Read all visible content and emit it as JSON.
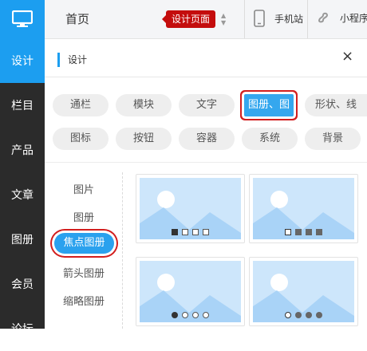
{
  "leftnav": {
    "items": [
      {
        "label": "设计"
      },
      {
        "label": "栏目"
      },
      {
        "label": "产品"
      },
      {
        "label": "文章"
      },
      {
        "label": "图册"
      },
      {
        "label": "会员"
      },
      {
        "label": "论坛"
      }
    ],
    "active_index": 0
  },
  "topbar": {
    "home": "首页",
    "badge": "设计页面",
    "mobile": "手机站",
    "mini": "小程序"
  },
  "panel": {
    "title": "设计",
    "close": "×"
  },
  "chips": {
    "row1": [
      "通栏",
      "模块",
      "文字",
      "图册、图",
      "形状、线"
    ],
    "row2": [
      "图标",
      "按钮",
      "容器",
      "系统",
      "背景"
    ],
    "selected": "图册、图"
  },
  "sublist": {
    "items": [
      "图片",
      "图册",
      "焦点图册",
      "箭头图册",
      "缩略图册"
    ],
    "selected": "焦点图册"
  },
  "colors": {
    "accent": "#1c9ef0",
    "highlight_border": "#d21e1e",
    "badge": "#c40d0d",
    "nav_bg": "#2b2b2b"
  }
}
